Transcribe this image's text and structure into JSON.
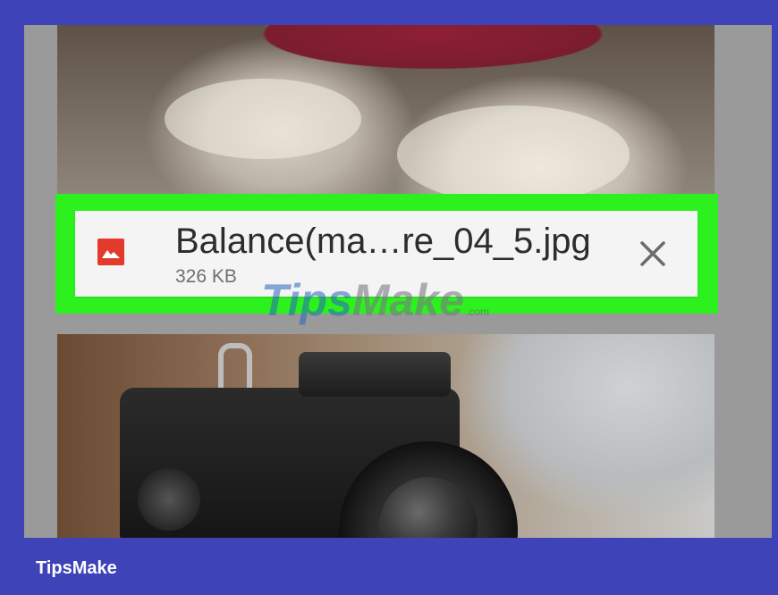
{
  "download": {
    "file_name": "Balance(ma…re_04_5.jpg",
    "file_size": "326 KB",
    "file_icon": "image-file-icon",
    "close_icon": "close-icon"
  },
  "watermark": {
    "part1": "Tips",
    "part2": "Make",
    "tld": ".com"
  },
  "footer": {
    "brand": "TipsMake"
  },
  "colors": {
    "frame": "#3f43b8",
    "highlight": "#2df11f",
    "file_icon": "#e23b2b"
  }
}
